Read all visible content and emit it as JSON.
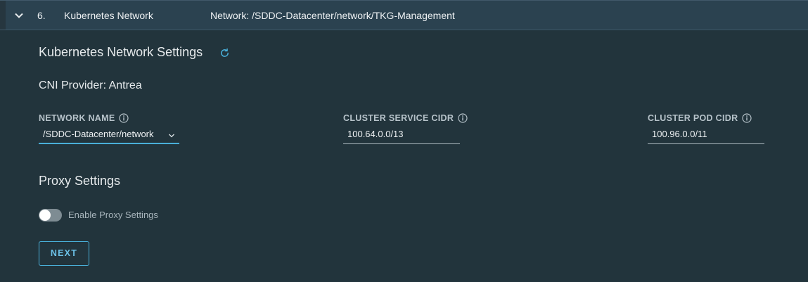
{
  "step": {
    "number": "6.",
    "title": "Kubernetes Network",
    "summary": "Network: /SDDC-Datacenter/network/TKG-Management"
  },
  "network_settings": {
    "title": "Kubernetes Network Settings",
    "cni_provider": "CNI Provider: Antrea"
  },
  "fields": {
    "network_name": {
      "label": "NETWORK NAME",
      "value": "/SDDC-Datacenter/network"
    },
    "cluster_service_cidr": {
      "label": "CLUSTER SERVICE CIDR",
      "value": "100.64.0.0/13"
    },
    "cluster_pod_cidr": {
      "label": "CLUSTER POD CIDR",
      "value": "100.96.0.0/11"
    }
  },
  "proxy": {
    "title": "Proxy Settings",
    "toggle_label": "Enable Proxy Settings",
    "enabled": false
  },
  "actions": {
    "next_label": "NEXT"
  },
  "icons": {
    "collapse": "chevron-down-icon",
    "refresh": "refresh-icon",
    "info": "info-icon",
    "dropdown": "chevron-down-icon"
  },
  "colors": {
    "background": "#22343c",
    "header": "#2b4250",
    "accent": "#49afd9"
  }
}
